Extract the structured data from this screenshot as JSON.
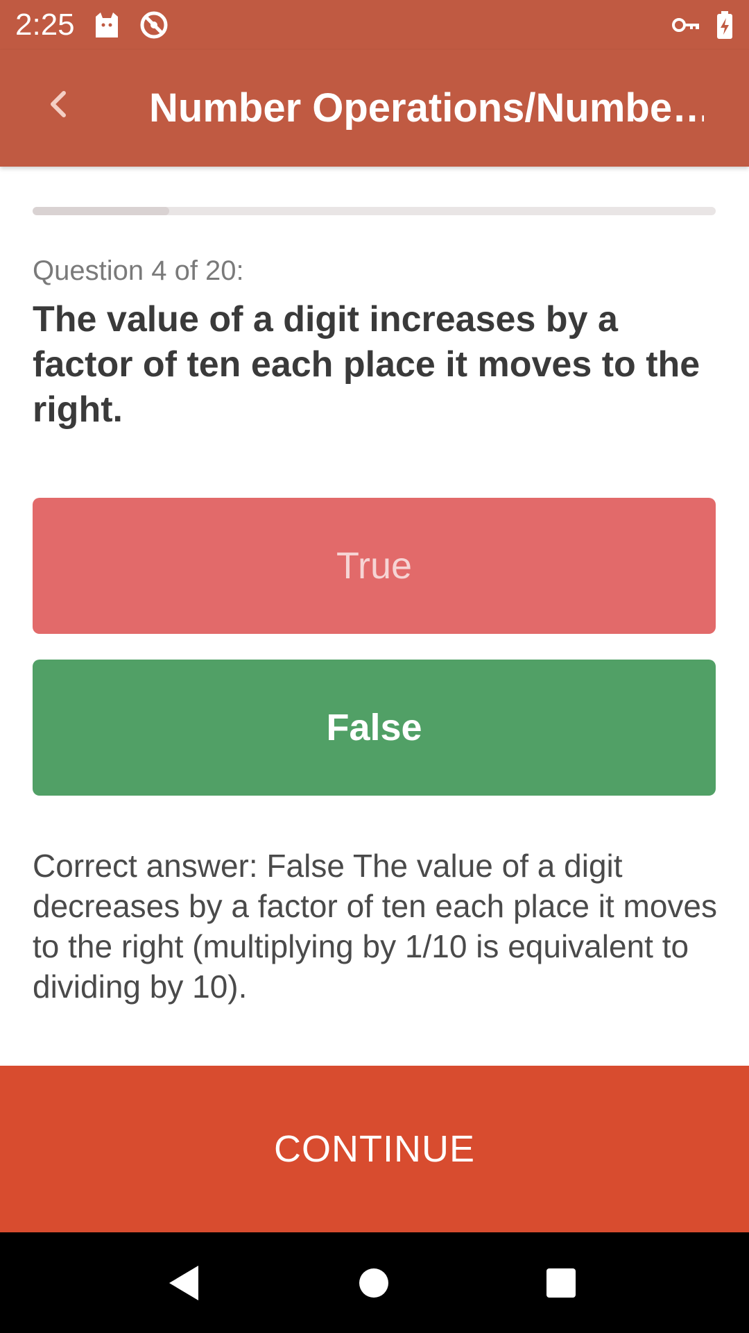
{
  "status_bar": {
    "time": "2:25",
    "icons": [
      "cat-notification-icon",
      "blocked-icon",
      "vpn-key-icon",
      "battery-charging-icon"
    ]
  },
  "app_bar": {
    "title": "Number Operations/Numbe…",
    "back_icon": "chevron-left-icon"
  },
  "progress": {
    "fraction": 0.2
  },
  "question": {
    "counter": "Question 4 of 20:",
    "text": "The value of a digit increases by a factor of ten each place it moves to the right."
  },
  "answers": [
    {
      "label": "True",
      "state": "incorrect"
    },
    {
      "label": "False",
      "state": "correct"
    }
  ],
  "explanation": "Correct answer: False The value of a digit decreases by a factor of ten each place it moves to the right (multiplying by 1/10 is equivalent to dividing by 10).",
  "continue_label": "CONTINUE",
  "colors": {
    "header": "#c05a42",
    "continue": "#d84c2f",
    "incorrect": "#e26a6a",
    "correct": "#51a066"
  },
  "nav_bar": {
    "icons": [
      "back-triangle-icon",
      "home-circle-icon",
      "recents-square-icon"
    ]
  }
}
